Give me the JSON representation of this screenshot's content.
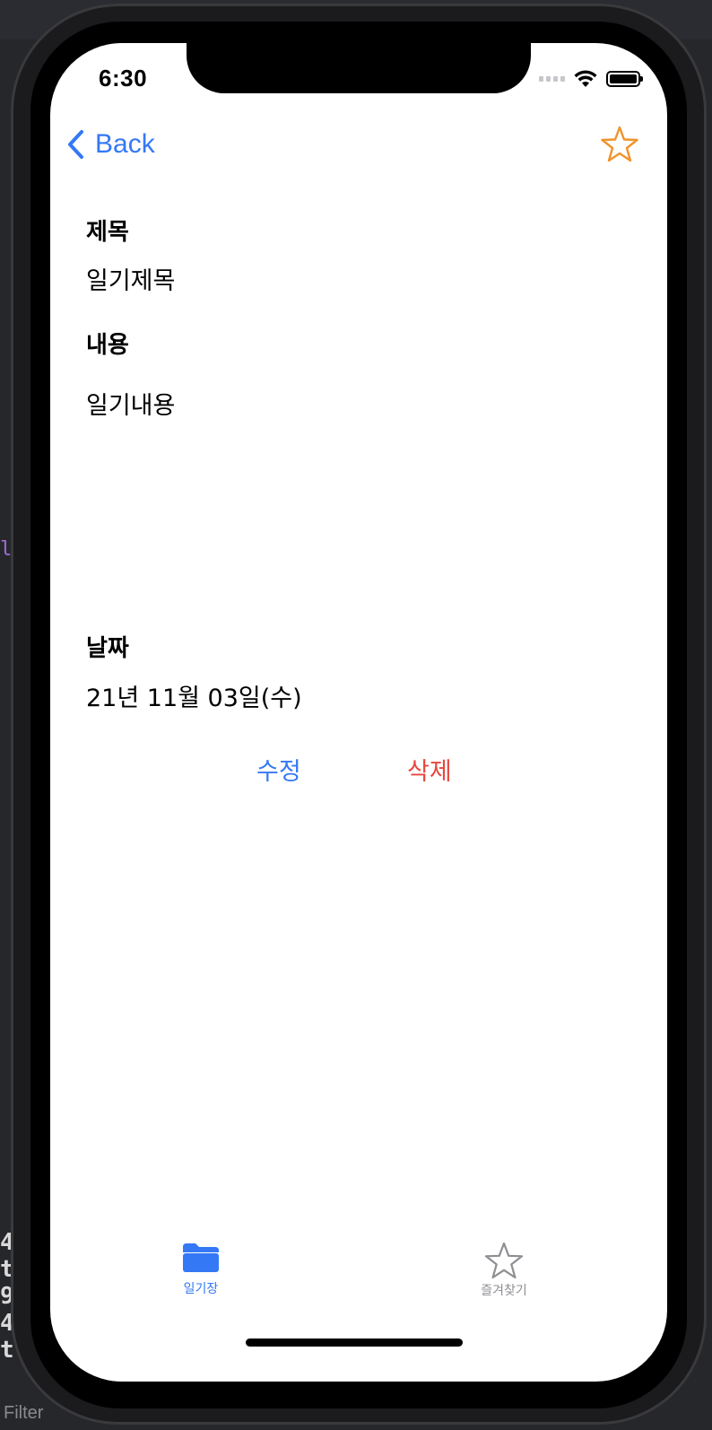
{
  "status_bar": {
    "time": "6:30"
  },
  "nav": {
    "back_label": "Back",
    "favorite_icon": "star-outline-icon",
    "favorite_color": "#f0932b"
  },
  "diary": {
    "title_label": "제목",
    "title_value": "일기제목",
    "content_label": "내용",
    "content_value": "일기내용",
    "date_label": "날짜",
    "date_value": "21년 11월 03일(수)"
  },
  "actions": {
    "edit_label": "수정",
    "edit_color": "#3478f6",
    "delete_label": "삭제",
    "delete_color": "#e8473d"
  },
  "tab_bar": {
    "tabs": [
      {
        "label": "일기장",
        "icon": "folder-icon",
        "selected": true,
        "color": "#3478f6"
      },
      {
        "label": "즐겨찾기",
        "icon": "star-outline-icon",
        "selected": false,
        "color": "#8e8e93"
      }
    ]
  },
  "background": {
    "filter_label": "Filter"
  }
}
